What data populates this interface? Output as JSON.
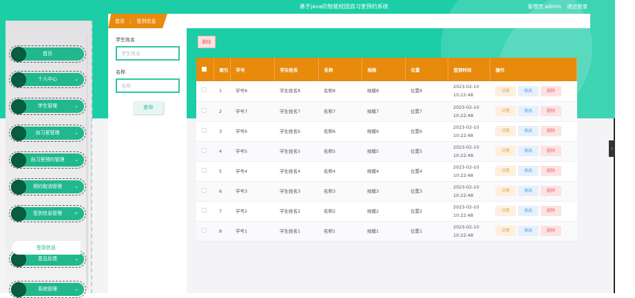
{
  "header": {
    "title": "基于java的智能校园自习室预约系统",
    "user": "管理员 admin",
    "logout": "退出登录"
  },
  "breadcrumb": {
    "home": "首页",
    "sep": "⋮",
    "current": "签到信息"
  },
  "sidebar": {
    "items": [
      {
        "label": "首页",
        "chevron": ""
      },
      {
        "label": "个人中心",
        "chevron": "⌄"
      },
      {
        "label": "学生管理",
        "chevron": "⌄"
      },
      {
        "label": "自习室管理",
        "chevron": "⌄"
      },
      {
        "label": "自习室预约管理",
        "chevron": "⌄"
      },
      {
        "label": "预约取消管理",
        "chevron": "⌄"
      },
      {
        "label": "签到信息管理",
        "chevron": "⌐"
      },
      {
        "label": "意见反馈",
        "chevron": "⌄"
      },
      {
        "label": "系统管理",
        "chevron": "⌄"
      }
    ],
    "subitem": "签到信息"
  },
  "search": {
    "field1_label": "学生姓名",
    "field1_placeholder": "学生姓名",
    "field2_label": "名称",
    "field2_placeholder": "名称",
    "query": "查询"
  },
  "toolbar": {
    "delete": "删除"
  },
  "table": {
    "headers": [
      "",
      "索引",
      "学号",
      "学生姓名",
      "名称",
      "规格",
      "位置",
      "签到时间",
      "操作"
    ],
    "actions": {
      "detail": "详情",
      "edit": "修改",
      "delete": "删除"
    },
    "rows": [
      [
        "1",
        "学号8",
        "学生姓名8",
        "名称8",
        "规模8",
        "位置8",
        "2023-02-10 10:22:48"
      ],
      [
        "2",
        "学号7",
        "学生姓名7",
        "名称7",
        "规模7",
        "位置7",
        "2023-02-10 10:22:48"
      ],
      [
        "3",
        "学号6",
        "学生姓名6",
        "名称6",
        "规模6",
        "位置6",
        "2023-02-10 10:22:48"
      ],
      [
        "4",
        "学号5",
        "学生姓名5",
        "名称5",
        "规模5",
        "位置5",
        "2023-02-10 10:22:48"
      ],
      [
        "5",
        "学号4",
        "学生姓名4",
        "名称4",
        "规模4",
        "位置4",
        "2023-02-10 10:22:48"
      ],
      [
        "6",
        "学号3",
        "学生姓名3",
        "名称3",
        "规模3",
        "位置3",
        "2023-02-10 10:22:48"
      ],
      [
        "7",
        "学号2",
        "学生姓名2",
        "名称2",
        "规模2",
        "位置2",
        "2023-02-10 10:22:48"
      ],
      [
        "8",
        "学号1",
        "学生姓名1",
        "名称1",
        "规模1",
        "位置1",
        "2023-02-10 10:22:48"
      ]
    ]
  },
  "colors": {
    "primary": "#1ccda6",
    "accent": "#e88a0c",
    "menu": "#21b88e"
  }
}
